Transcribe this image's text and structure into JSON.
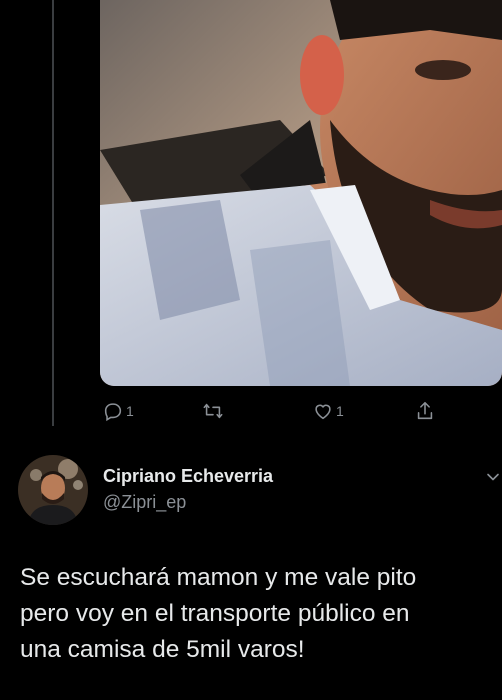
{
  "previous_tweet": {
    "media": {
      "description_icon": "photo-selfie"
    },
    "actions": {
      "reply_count": "1",
      "retweet_count": "",
      "like_count": "1"
    }
  },
  "tweet": {
    "author": {
      "name": "Cipriano Echeverria",
      "handle": "@Zipri_ep"
    },
    "text": "Se escuchará mamon y me vale pito\npero voy en el transporte público en\nuna camisa de 5mil varos!"
  },
  "colors": {
    "background": "#000000",
    "text": "#e7e9ea",
    "secondary": "#8b9096",
    "thread_line": "#3a3d40"
  }
}
